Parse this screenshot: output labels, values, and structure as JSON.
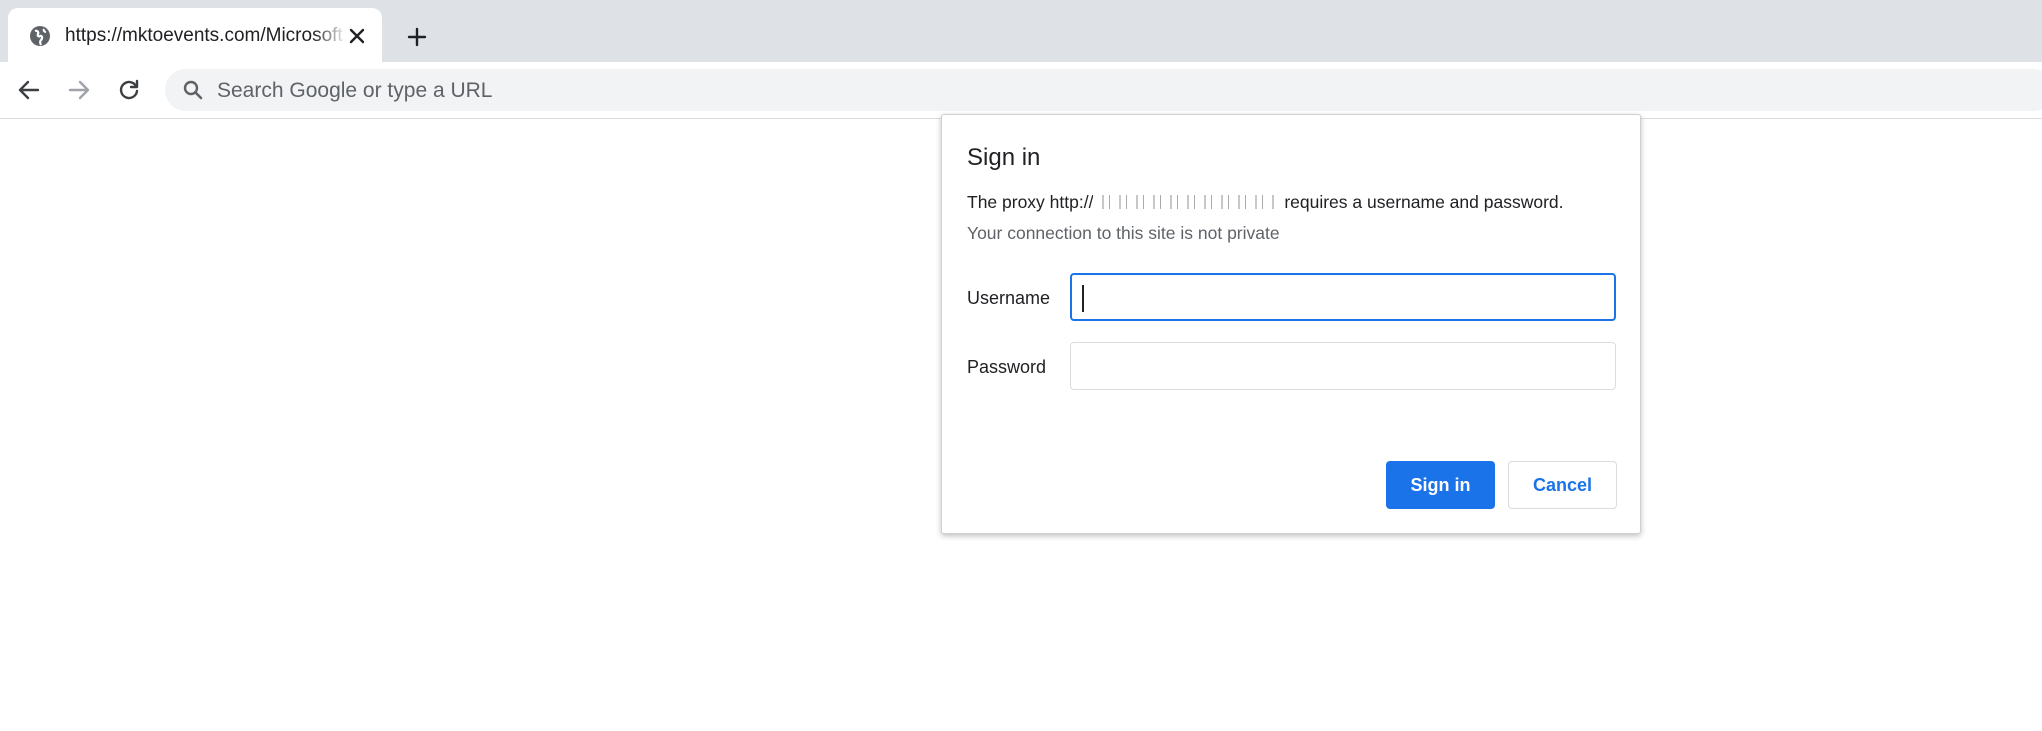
{
  "browser": {
    "tab": {
      "title": "https://mktoevents.com/Microsoft",
      "favicon": "globe-icon",
      "close_icon": "close-icon"
    },
    "new_tab_icon": "plus-icon",
    "toolbar": {
      "back_icon": "arrow-left-icon",
      "forward_icon": "arrow-right-icon",
      "reload_icon": "reload-icon",
      "omnibox_icon": "search-icon",
      "omnibox_placeholder": "Search Google or type a URL"
    }
  },
  "dialog": {
    "title": "Sign in",
    "message_prefix": "The proxy http://",
    "message_suffix": " requires a username and password.",
    "privacy_note": "Your connection to this site is not private",
    "username_label": "Username",
    "username_value": "",
    "password_label": "Password",
    "password_value": "",
    "sign_in_label": "Sign in",
    "cancel_label": "Cancel"
  },
  "colors": {
    "accent": "#1a73e8",
    "tabstrip_bg": "#dee1e6",
    "omnibox_bg": "#f1f3f4",
    "text_primary": "#202124",
    "text_secondary": "#5f6368"
  }
}
